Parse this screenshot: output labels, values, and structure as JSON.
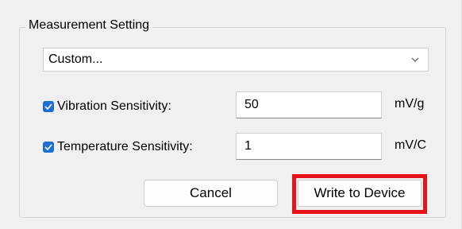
{
  "group": {
    "title": "Measurement Setting"
  },
  "preset": {
    "value": "Custom..."
  },
  "vibration": {
    "checked": true,
    "label": "Vibration Sensitivity:",
    "value": "50",
    "unit": "mV/g"
  },
  "temperature": {
    "checked": true,
    "label": "Temperature Sensitivity:",
    "value": "1",
    "unit": "mV/C"
  },
  "buttons": {
    "cancel": "Cancel",
    "write": "Write to Device"
  },
  "colors": {
    "checkbox": "#1f6ed4",
    "highlight": "#e8141c",
    "background": "#f0f0f0"
  },
  "icons": {
    "dropdown": "chevron-down-icon",
    "check": "checkmark-icon"
  }
}
